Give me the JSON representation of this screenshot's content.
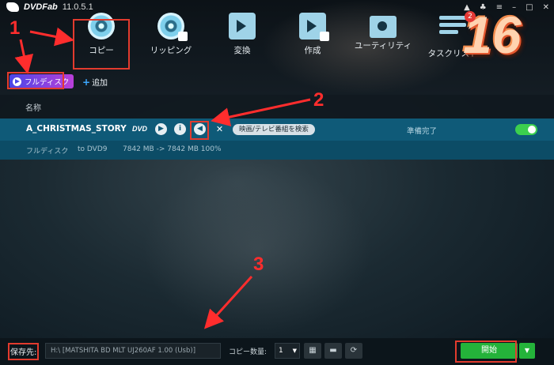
{
  "app": {
    "name": "DVDFab",
    "version": "11.0.5.1",
    "window_controls": [
      "pin-icon",
      "gift-icon",
      "menu-icon",
      "minimize-icon",
      "maximize-icon",
      "close-icon"
    ]
  },
  "modes": [
    {
      "label": "コピー",
      "icon": "copy-disc-icon"
    },
    {
      "label": "リッピング",
      "icon": "ripper-disc-icon"
    },
    {
      "label": "変換",
      "icon": "converter-film-icon"
    },
    {
      "label": "作成",
      "icon": "creator-film-icon"
    },
    {
      "label": "ユーティリティ",
      "icon": "utility-folder-icon"
    },
    {
      "label": "タスクリスト",
      "icon": "task-list-icon"
    }
  ],
  "task_badge": "2",
  "promo_badge": "16",
  "toolbar": {
    "full_disc": "フルディスク",
    "add": "追加"
  },
  "list": {
    "column_name": "名称",
    "title": {
      "name": "A_CHRISTMAS_STORY",
      "format_logo": "DVD",
      "search_button": "映画/テレビ番組を検索",
      "status": "準備完了",
      "mode": "フルディスク",
      "target": "to DVD9",
      "size": "7842 MB -> 7842 MB 100%"
    }
  },
  "bottom": {
    "save_label": "保存先:",
    "path": "H:\\ [MATSHITA BD MLT UJ260AF 1.00 (Usb)]",
    "copies_label": "コピー数量:",
    "copies_value": "1",
    "start": "開始"
  },
  "annotations": [
    "1",
    "2",
    "3"
  ],
  "colors": {
    "accent_green": "#24b33a",
    "selected_row": "#0f5a78",
    "annotation_red": "#e23b2e"
  }
}
